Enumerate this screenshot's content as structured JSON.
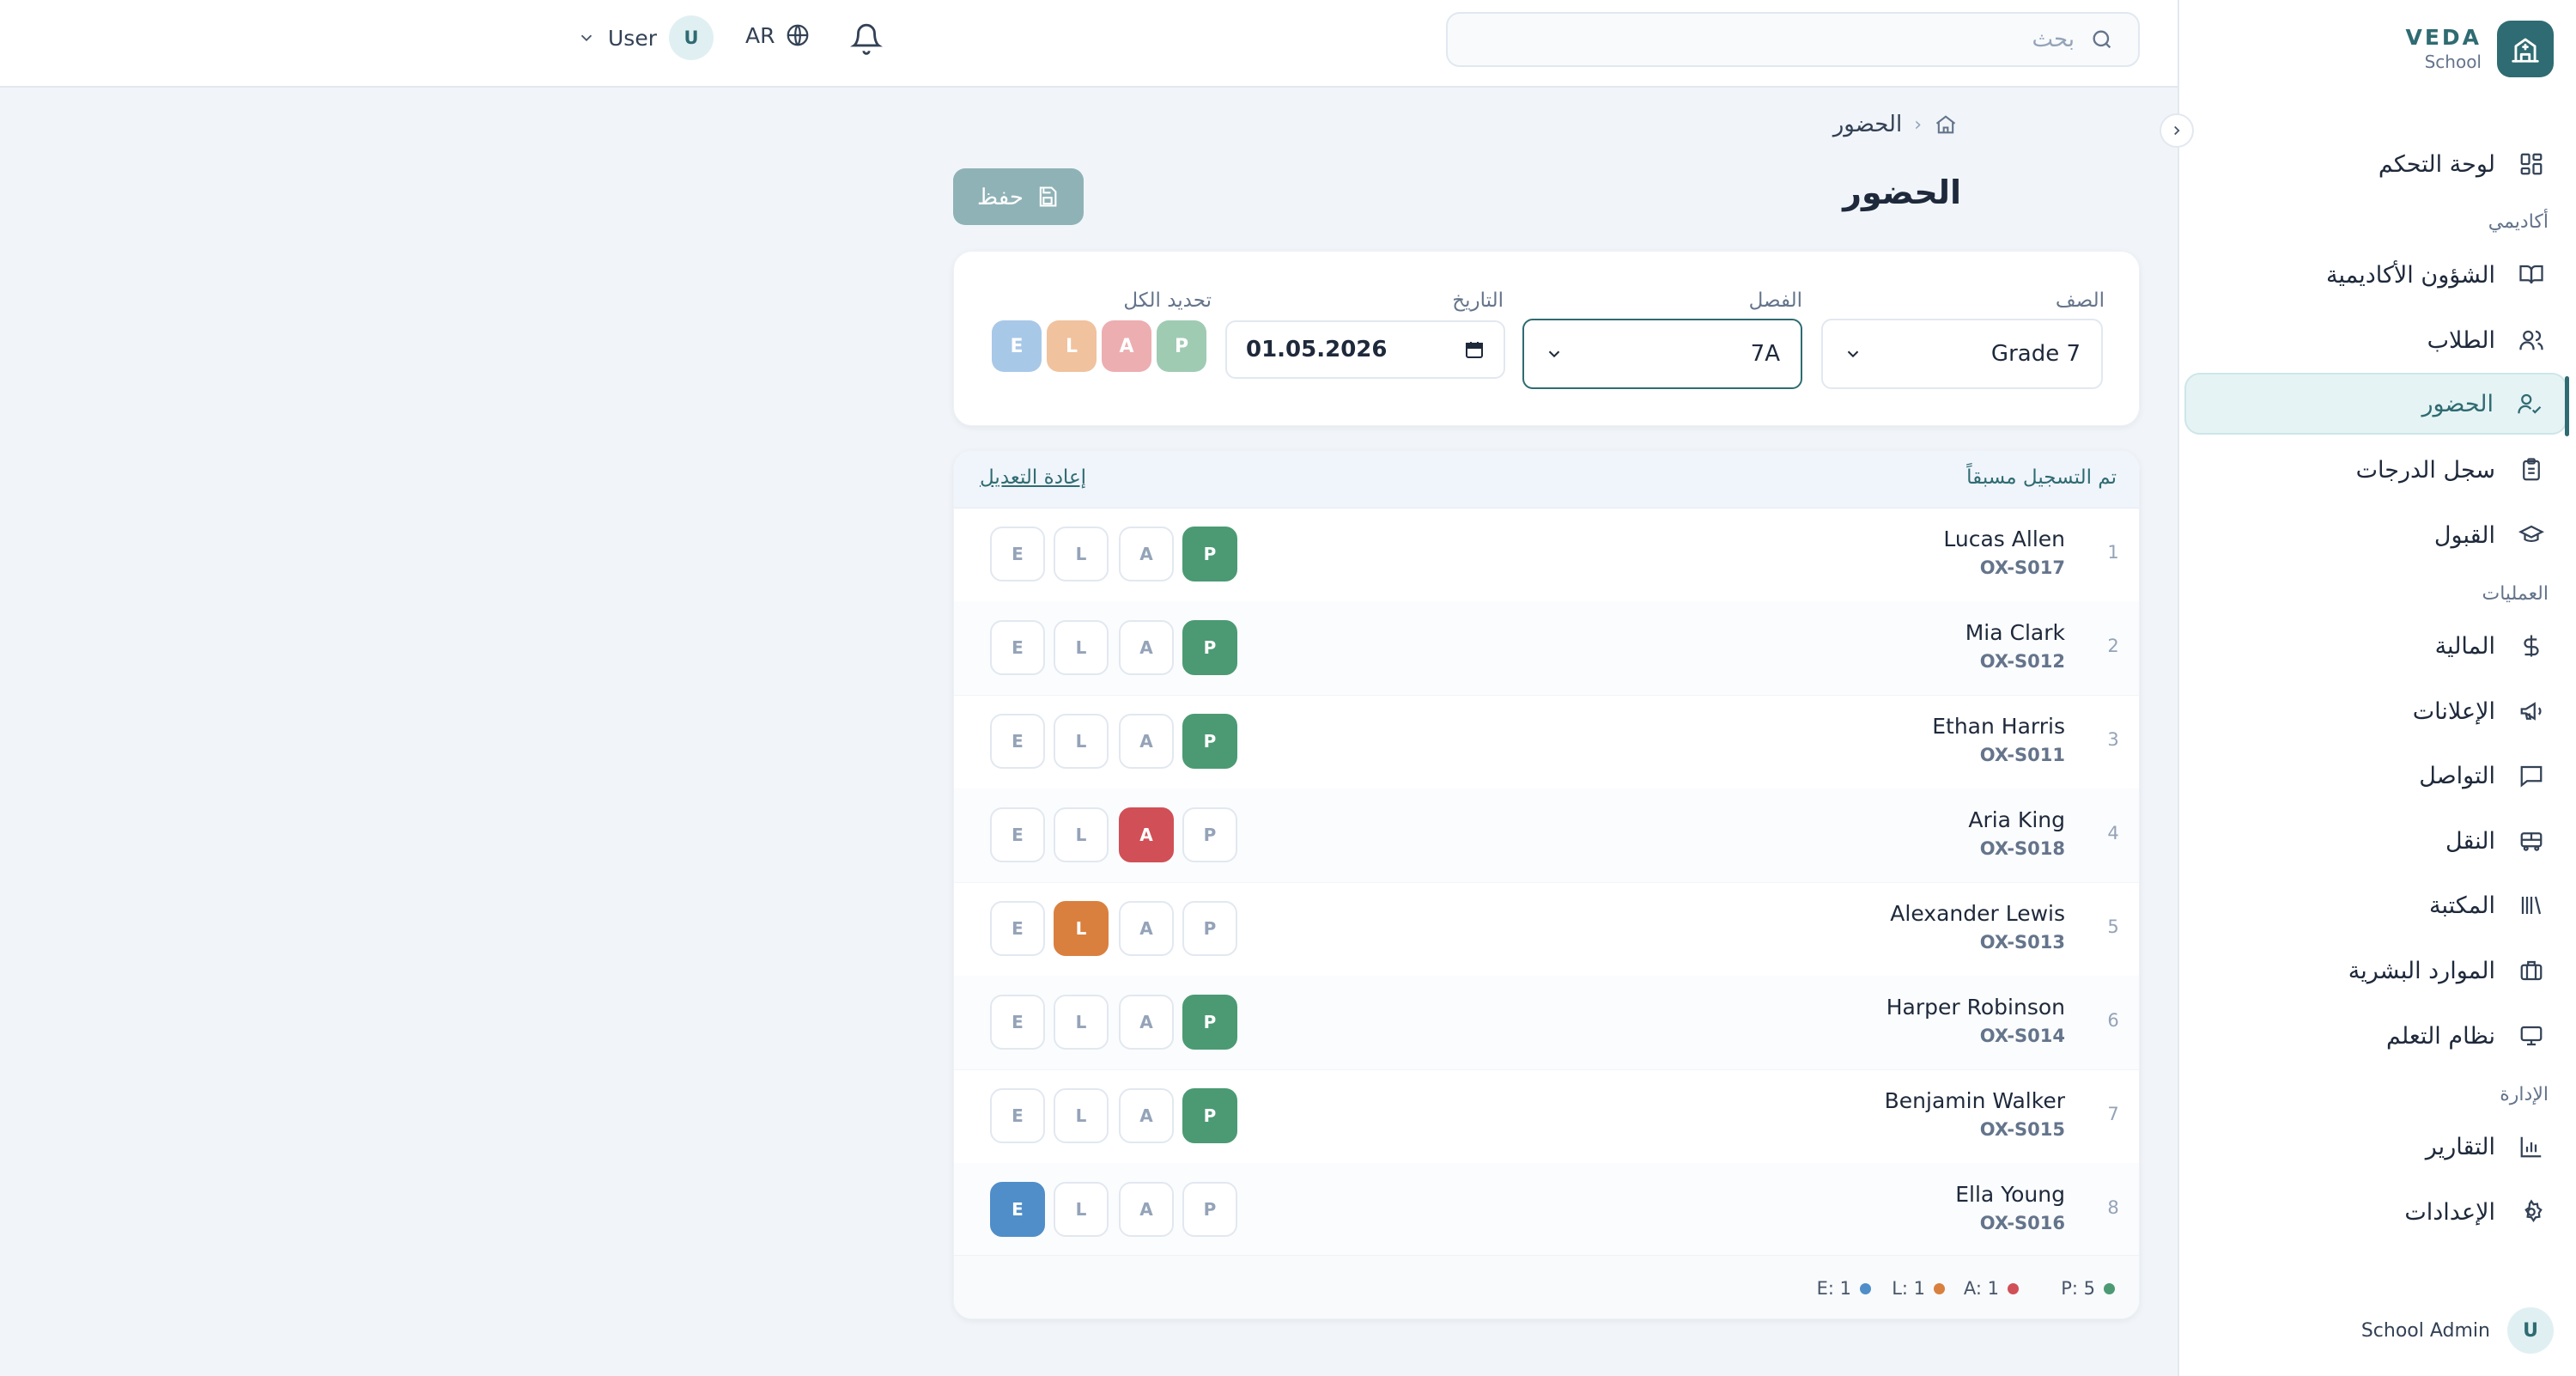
{
  "brand": {
    "name": "VEDA",
    "subtitle": "School"
  },
  "sidebar": {
    "items": [
      {
        "label": "لوحة التحكم",
        "icon": "dashboard-icon"
      },
      {
        "section": "أكاديمي"
      },
      {
        "label": "الشؤون الأكاديمية",
        "icon": "book-icon"
      },
      {
        "label": "الطلاب",
        "icon": "users-icon"
      },
      {
        "label": "الحضور",
        "icon": "user-check-icon",
        "active": true
      },
      {
        "label": "سجل الدرجات",
        "icon": "clipboard-icon"
      },
      {
        "label": "القبول",
        "icon": "graduation-cap-icon"
      },
      {
        "section": "العمليات"
      },
      {
        "label": "المالية",
        "icon": "dollar-icon"
      },
      {
        "label": "الإعلانات",
        "icon": "megaphone-icon"
      },
      {
        "label": "التواصل",
        "icon": "message-icon"
      },
      {
        "label": "النقل",
        "icon": "bus-icon"
      },
      {
        "label": "المكتبة",
        "icon": "library-icon"
      },
      {
        "label": "الموارد البشرية",
        "icon": "briefcase-icon"
      },
      {
        "label": "نظام التعلم",
        "icon": "monitor-icon"
      },
      {
        "section": "الإدارة"
      },
      {
        "label": "التقارير",
        "icon": "bar-chart-icon"
      },
      {
        "label": "الإعدادات",
        "icon": "gear-icon"
      }
    ],
    "user": {
      "initial": "U",
      "name": "School Admin"
    }
  },
  "header": {
    "search_placeholder": "بحث",
    "language": "AR",
    "user_name": "User",
    "user_initial": "U"
  },
  "breadcrumb": {
    "current": "الحضور"
  },
  "page": {
    "title": "الحضور",
    "save_label": "حفظ"
  },
  "filters": {
    "grade": {
      "label": "الصف",
      "value": "Grade 7"
    },
    "section": {
      "label": "الفصل",
      "value": "7A"
    },
    "date": {
      "label": "التاريخ",
      "value": "01.05.2026"
    },
    "bulk": {
      "label": "تحديد الكل",
      "options": [
        "P",
        "A",
        "L",
        "E"
      ]
    }
  },
  "table": {
    "status_text": "تم التسجيل مسبقاً",
    "reset_label": "إعادة التعديل",
    "options": [
      "P",
      "A",
      "L",
      "E"
    ],
    "rows": [
      {
        "index": "1",
        "name": "Lucas Allen",
        "id": "OX-S017",
        "status": "P"
      },
      {
        "index": "2",
        "name": "Mia Clark",
        "id": "OX-S012",
        "status": "P"
      },
      {
        "index": "3",
        "name": "Ethan Harris",
        "id": "OX-S011",
        "status": "P"
      },
      {
        "index": "4",
        "name": "Aria King",
        "id": "OX-S018",
        "status": "A"
      },
      {
        "index": "5",
        "name": "Alexander Lewis",
        "id": "OX-S013",
        "status": "L"
      },
      {
        "index": "6",
        "name": "Harper Robinson",
        "id": "OX-S014",
        "status": "P"
      },
      {
        "index": "7",
        "name": "Benjamin Walker",
        "id": "OX-S015",
        "status": "P"
      },
      {
        "index": "8",
        "name": "Ella Young",
        "id": "OX-S016",
        "status": "E"
      }
    ],
    "summary": [
      {
        "text": "P: 5",
        "color": "#4b9a73"
      },
      {
        "text": "A: 1",
        "color": "#d14f57"
      },
      {
        "text": "L: 1",
        "color": "#d9803f"
      },
      {
        "text": "E: 1",
        "color": "#4f8ec9"
      }
    ]
  },
  "colors": {
    "accent": "#2f6b72",
    "present": "#4b9a73",
    "absent": "#d14f57",
    "late": "#d9803f",
    "excused": "#4f8ec9"
  }
}
